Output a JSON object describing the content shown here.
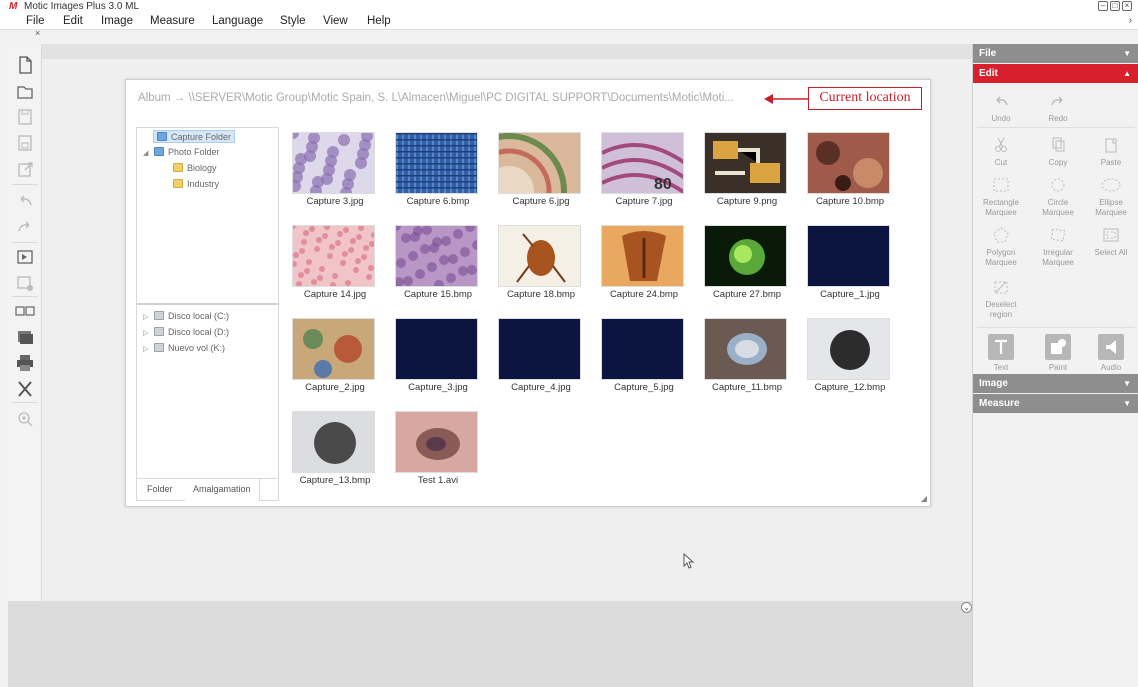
{
  "window": {
    "title": "Motic Images Plus 3.0 ML",
    "logo_glyph": "M",
    "min_glyph": "–",
    "max_glyph": "□",
    "close_glyph": "×"
  },
  "menu": {
    "items": [
      "File",
      "Edit",
      "Image",
      "Measure",
      "Language",
      "Style",
      "View",
      "Help"
    ],
    "more_glyph": "›",
    "close_glyph": "×"
  },
  "album": {
    "path": "Album → \\\\SERVER\\Motic Group\\Motic Spain, S. L\\Almacen\\Miguel\\PC DIGITAL SUPPORT\\Documents\\Motic\\Moti..."
  },
  "callout": {
    "label": "Current location",
    "color": "#c8202b"
  },
  "tree": {
    "nodes": [
      {
        "label": "Capture Folder",
        "expander": "",
        "icon": "capture-folder-icon",
        "selected": true
      },
      {
        "label": "Photo Folder",
        "expander": "◢",
        "icon": "photo-folder-icon",
        "selected": false
      },
      {
        "label": "Biology",
        "expander": "",
        "icon": "folder-icon",
        "selected": false
      },
      {
        "label": "Industry",
        "expander": "",
        "icon": "folder-icon",
        "selected": false
      }
    ],
    "drives": [
      {
        "label": "Disco local (C:)",
        "expander": "▷",
        "icon": "drive-icon"
      },
      {
        "label": "Disco local (D:)",
        "expander": "▷",
        "icon": "drive-icon"
      },
      {
        "label": "Nuevo vol (K:)",
        "expander": "▷",
        "icon": "drive-icon"
      }
    ],
    "tabs": {
      "folder": "Folder",
      "amalgamation": "Amalgamation"
    }
  },
  "thumbnails": [
    {
      "name": "Capture 3.jpg",
      "kind": "cells"
    },
    {
      "name": "Capture 6.bmp",
      "kind": "fabric"
    },
    {
      "name": "Capture 6.jpg",
      "kind": "stem"
    },
    {
      "name": "Capture 7.jpg",
      "kind": "banknote"
    },
    {
      "name": "Capture 9.png",
      "kind": "circuit"
    },
    {
      "name": "Capture 10.bmp",
      "kind": "rock"
    },
    {
      "name": "Capture 14.jpg",
      "kind": "pink"
    },
    {
      "name": "Capture 15.bmp",
      "kind": "purple"
    },
    {
      "name": "Capture 18.bmp",
      "kind": "flea"
    },
    {
      "name": "Capture 24.bmp",
      "kind": "insect"
    },
    {
      "name": "Capture 27.bmp",
      "kind": "green"
    },
    {
      "name": "Capture_1.jpg",
      "kind": "dark"
    },
    {
      "name": "Capture_2.jpg",
      "kind": "mixed"
    },
    {
      "name": "Capture_3.jpg",
      "kind": "dark"
    },
    {
      "name": "Capture_4.jpg",
      "kind": "dark"
    },
    {
      "name": "Capture_5.jpg",
      "kind": "dark"
    },
    {
      "name": "Capture_11.bmp",
      "kind": "section"
    },
    {
      "name": "Capture_12.bmp",
      "kind": "circle"
    },
    {
      "name": "Capture_13.bmp",
      "kind": "circle2"
    },
    {
      "name": "Test 1.avi",
      "kind": "tissue"
    }
  ],
  "sidebar": {
    "file": "File",
    "edit": "Edit",
    "image": "Image",
    "measure": "Measure",
    "collapsed_glyph": "▼",
    "expanded_glyph": "▲",
    "tools": {
      "undo": "Undo",
      "redo": "Redo",
      "cut": "Cut",
      "copy": "Copy",
      "paste": "Paste",
      "rect": "Rectangle Marquee",
      "circle": "Circle Marquee",
      "ellipse": "Ellipse Marquee",
      "polygon": "Polygon Marquee",
      "irregular": "Irregular Marquee",
      "selectall": "Select All",
      "deselect": "Deselect region",
      "text": "Text",
      "paint": "Paint",
      "audio": "Audio"
    }
  },
  "bottom": {
    "scroll_glyph": "⌄"
  },
  "grip": "◢",
  "colors": {
    "accent": "#d8202c",
    "panel_header": "#8e8e8e"
  }
}
